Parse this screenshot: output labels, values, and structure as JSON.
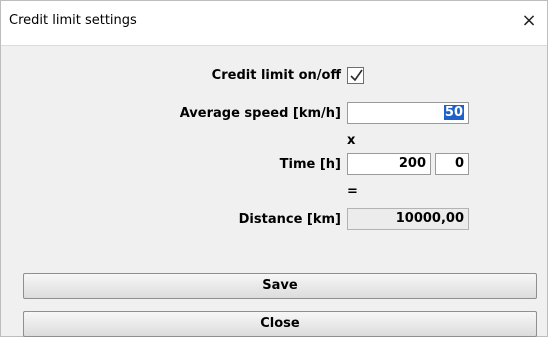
{
  "window": {
    "title": "Credit limit settings",
    "close_glyph": "×"
  },
  "form": {
    "credit_limit_label": "Credit limit on/off",
    "credit_limit_checked": true,
    "average_speed_label": "Average speed [km/h]",
    "average_speed_value": "50",
    "multiply_symbol": "x",
    "time_label": "Time [h]",
    "time_hours_value": "200",
    "time_minutes_value": "0",
    "equals_symbol": "=",
    "distance_label": "Distance [km]",
    "distance_value": "10000,00"
  },
  "buttons": {
    "save_label": "Save",
    "close_label": "Close"
  },
  "icons": {
    "checkmark": "checkmark-icon",
    "close": "close-icon"
  }
}
